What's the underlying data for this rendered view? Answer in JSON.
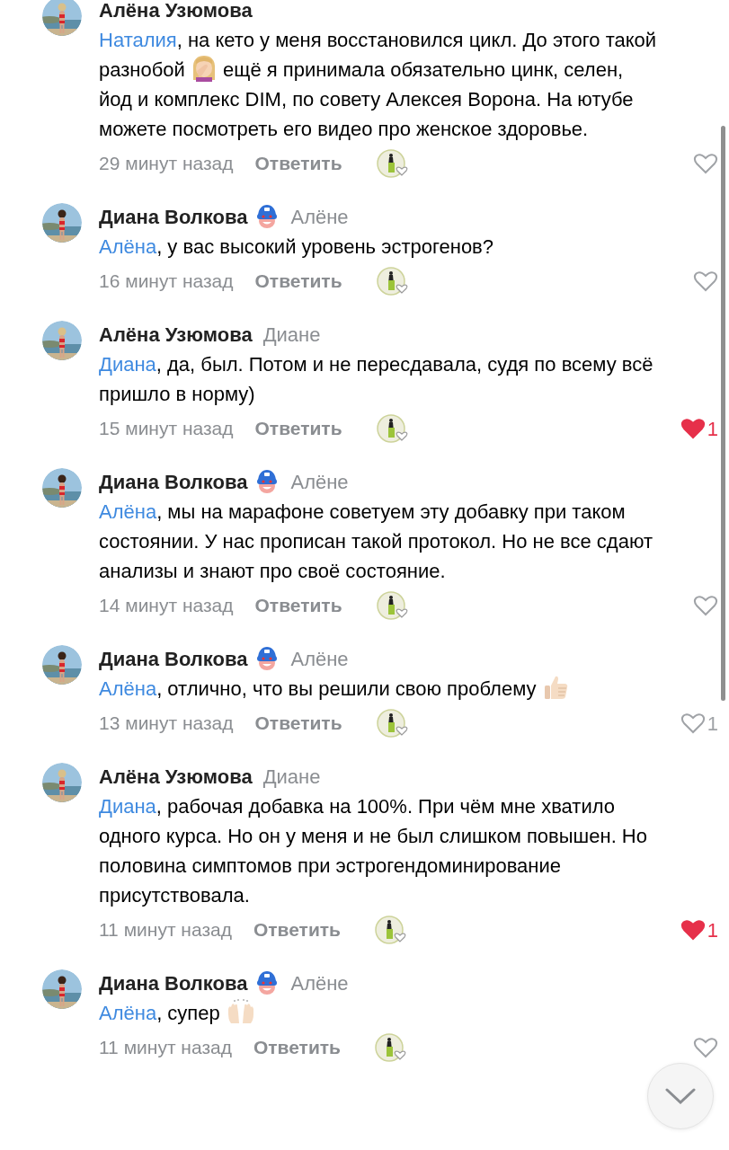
{
  "comments": [
    {
      "author": "Алёна Узюмова",
      "badge": false,
      "mention": "Наталия",
      "parts": [
        {
          "kind": "text",
          "text": ", на кето у меня восстановился цикл. До этого такой разнобой "
        },
        {
          "kind": "facepalm"
        },
        {
          "kind": "text",
          "text": " ещё я принимала обязательно цинк, селен, йод и комплекс DIM, по совету Алексея Ворона. На ютубе можете посмотреть его видео про женское здоровье."
        }
      ],
      "time": "29 минут назад",
      "reply": "Ответить",
      "liked": false
    },
    {
      "author": "Диана Волкова",
      "badge": true,
      "reply_to": "Алёне",
      "mention": "Алёна",
      "parts": [
        {
          "kind": "text",
          "text": ", у вас высокий уровень эстрогенов?"
        }
      ],
      "time": "16 минут назад",
      "reply": "Ответить",
      "liked": false
    },
    {
      "author": "Алёна Узюмова",
      "badge": false,
      "reply_to": "Диане",
      "mention": "Диана",
      "parts": [
        {
          "kind": "text",
          "text": ", да, был. Потом и не пересдавала, судя по всему всё пришло в норму)"
        }
      ],
      "time": "15 минут назад",
      "reply": "Ответить",
      "liked": true,
      "likes": "1"
    },
    {
      "author": "Диана Волкова",
      "badge": true,
      "reply_to": "Алёне",
      "mention": "Алёна",
      "parts": [
        {
          "kind": "text",
          "text": ", мы на марафоне советуем эту добавку при таком состоянии. У нас прописан такой протокол. Но не все сдают анализы и знают про своё состояние."
        }
      ],
      "time": "14 минут назад",
      "reply": "Ответить",
      "liked": false
    },
    {
      "author": "Диана Волкова",
      "badge": true,
      "reply_to": "Алёне",
      "mention": "Алёна",
      "parts": [
        {
          "kind": "text",
          "text": ", отлично, что вы решили свою проблему "
        },
        {
          "kind": "thumbsup"
        }
      ],
      "time": "13 минут назад",
      "reply": "Ответить",
      "liked": false,
      "likes": "1"
    },
    {
      "author": "Алёна Узюмова",
      "badge": false,
      "reply_to": "Диане",
      "mention": "Диана",
      "parts": [
        {
          "kind": "text",
          "text": ", рабочая добавка на 100%. При чём мне хватило одного курса. Но он у меня и не был слишком повышен. Но половина симптомов при эстрогендоминирование присутствовала."
        }
      ],
      "time": "11 минут назад",
      "reply": "Ответить",
      "liked": true,
      "likes": "1"
    },
    {
      "author": "Диана Волкова",
      "badge": true,
      "reply_to": "Алёне",
      "mention": "Алёна",
      "parts": [
        {
          "kind": "text",
          "text": ", супер "
        },
        {
          "kind": "raisedhands"
        }
      ],
      "time": "11 минут назад",
      "reply": "Ответить",
      "liked": false
    }
  ]
}
